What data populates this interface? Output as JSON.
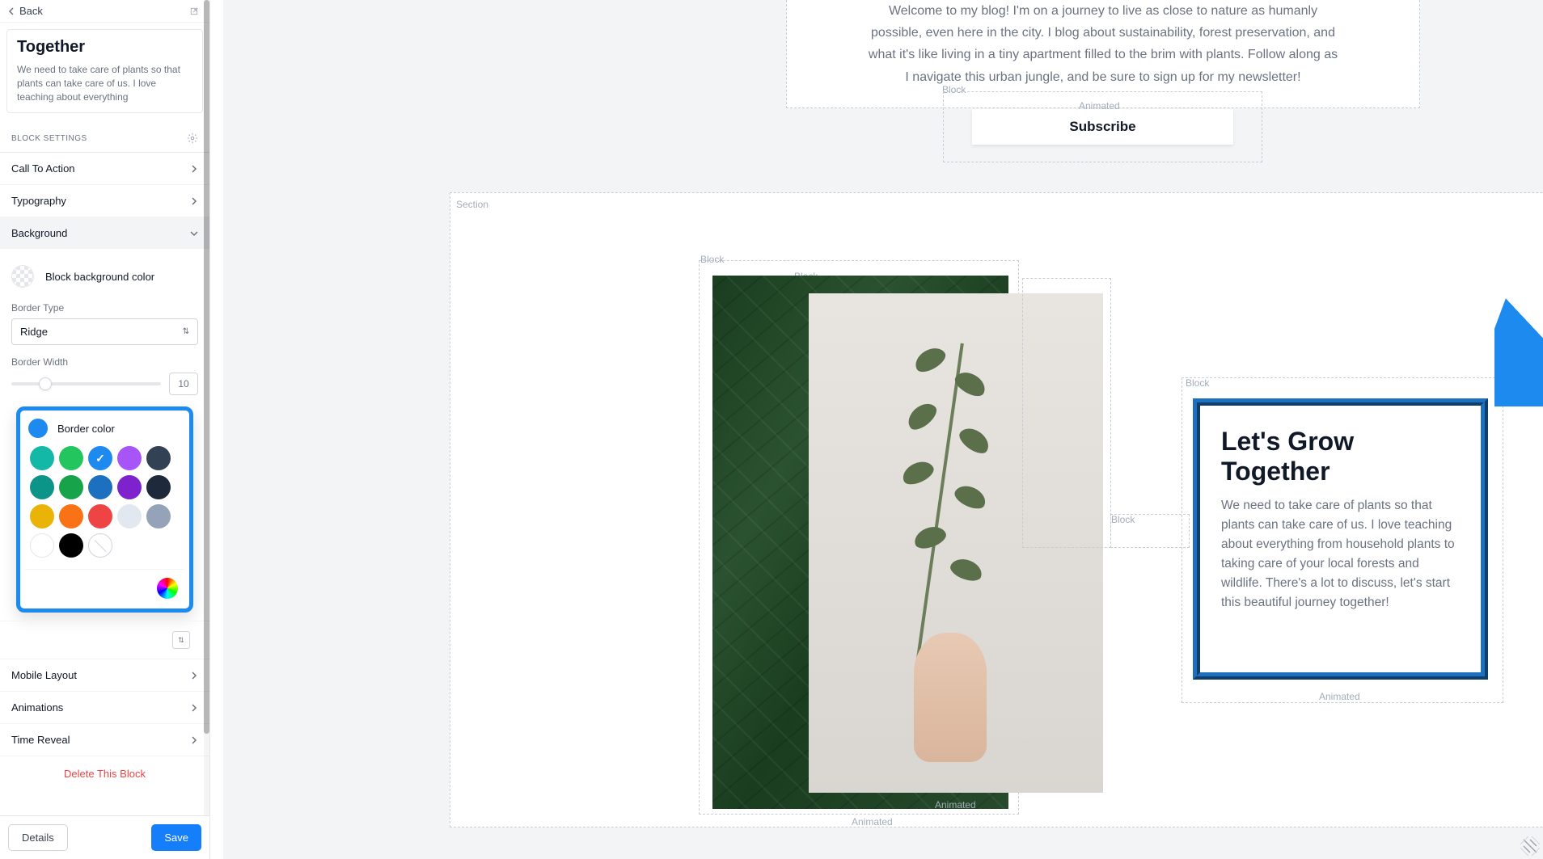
{
  "back_label": "Back",
  "preview": {
    "title": "Together",
    "body": "We need to take care of plants so that plants can take care of us. I love teaching about everything"
  },
  "block_settings_header": "BLOCK SETTINGS",
  "accordion": {
    "cta": "Call To Action",
    "typography": "Typography",
    "background": "Background",
    "mobile": "Mobile Layout",
    "animations": "Animations",
    "time_reveal": "Time Reveal"
  },
  "bg": {
    "block_bg_label": "Block background color",
    "border_type_label": "Border Type",
    "border_type_value": "Ridge",
    "border_width_label": "Border Width",
    "border_width_value": "10",
    "border_color_label": "Border color",
    "selected_color": "#1d8af0",
    "palette_row1": [
      "#14b8a6",
      "#22c55e",
      "#1d8af0",
      "#a855f7",
      "#334155"
    ],
    "palette_row2": [
      "#0d9488",
      "#16a34a",
      "#1d6fbf",
      "#7e22ce",
      "#1e293b"
    ],
    "palette_row3": [
      "#eab308",
      "#f97316",
      "#ef4444",
      "#e2e8f0",
      "#94a3b8"
    ],
    "palette_row4": [
      "#ffffff",
      "#000000",
      "none",
      "",
      ""
    ]
  },
  "delete_label": "Delete This Block",
  "footer": {
    "details": "Details",
    "save": "Save"
  },
  "canvas": {
    "intro_text": "Welcome to my blog! I'm on a journey to live as close to nature as humanly possible, even here in the city. I blog about sustainability, forest preservation, and what it's like living in a tiny apartment filled to the brim with plants. Follow along as I navigate this urban jungle, and be sure to sign up for my newsletter!",
    "subscribe": "Subscribe",
    "card_title": "Let's Grow Together",
    "card_body": "We need to take care of plants so that plants can take care of us. I love teaching about everything from household plants to taking care of your local forests and wildlife. There's a lot to discuss, let's start this beautiful journey together!",
    "labels": {
      "block": "Block",
      "section": "Section",
      "animated": "Animated"
    }
  }
}
